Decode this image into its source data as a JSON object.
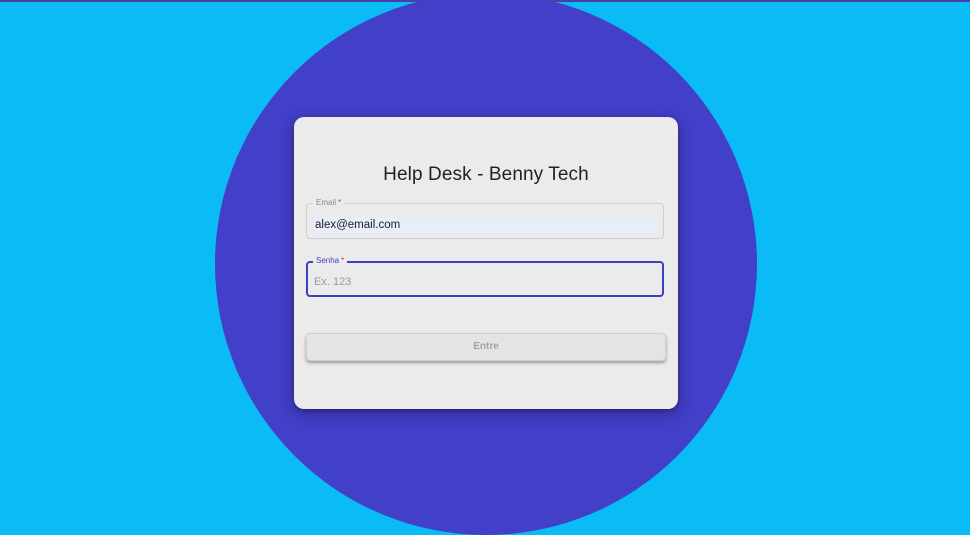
{
  "login": {
    "title": "Help Desk - Benny Tech",
    "email": {
      "label": "Email",
      "required_mark": "*",
      "value": "alex@email.com"
    },
    "senha": {
      "label": "Senha",
      "required_mark": "*",
      "placeholder": "Ex. 123",
      "value": ""
    },
    "submit_label": "Entre"
  },
  "colors": {
    "background": "#0bbbf5",
    "circle": "#423fc8",
    "card": "#ecebeb",
    "focus_accent": "#3f3fc6",
    "required": "#dd3333"
  }
}
